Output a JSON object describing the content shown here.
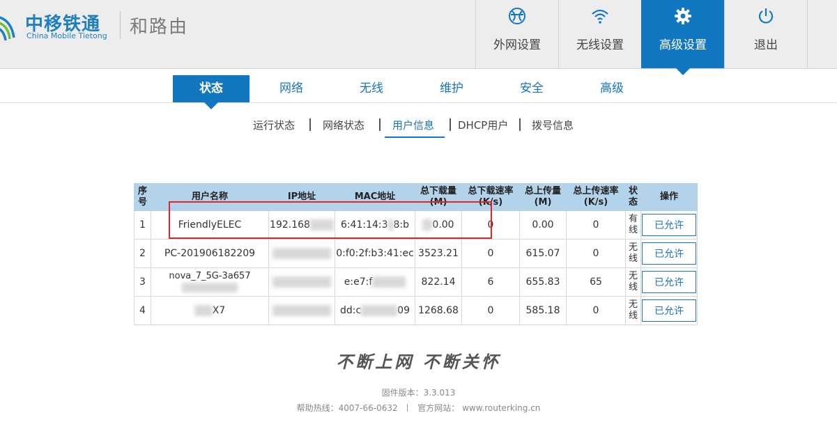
{
  "brand": {
    "name_cn": "中移铁通",
    "name_en": "China Mobile Tietong",
    "product": "和路由",
    "color": "#1d7fc4"
  },
  "top_nav": [
    {
      "label": "外网设置",
      "icon": "globe-icon"
    },
    {
      "label": "无线设置",
      "icon": "wifi-icon"
    },
    {
      "label": "高级设置",
      "icon": "gear-icon",
      "active": true
    },
    {
      "label": "退出",
      "icon": "power-icon"
    }
  ],
  "sub_tabs": [
    {
      "label": "状态",
      "active": true
    },
    {
      "label": "网络"
    },
    {
      "label": "无线"
    },
    {
      "label": "维护"
    },
    {
      "label": "安全"
    },
    {
      "label": "高级"
    }
  ],
  "third_nav": [
    {
      "label": "运行状态"
    },
    {
      "label": "网络状态"
    },
    {
      "label": "用户信息",
      "active": true
    },
    {
      "label": "DHCP用户"
    },
    {
      "label": "拨号信息"
    }
  ],
  "table": {
    "headers": [
      "序号",
      "用户名称",
      "IP地址",
      "MAC地址",
      "总下载量(M)",
      "总下载速率(K/s)",
      "总上传量(M)",
      "总上传速率(K/s)",
      "状态",
      "操作"
    ],
    "rows": [
      {
        "index": "1",
        "name": "FriendlyELEC",
        "ip": "192.168",
        "mac_a": "6:41:14:3",
        "mac_b": "8:b",
        "dl_total": "0.00",
        "dl_rate": "0",
        "ul_total": "0.00",
        "ul_rate": "0",
        "status": "有线",
        "action": "已允许"
      },
      {
        "index": "2",
        "name": "PC-201906182209",
        "ip": "",
        "mac_a": "0:f0:2f:b3:41:ec",
        "mac_b": "",
        "dl_total": "3523.21",
        "dl_rate": "0",
        "ul_total": "615.07",
        "ul_rate": "0",
        "status": "无线",
        "action": "已允许"
      },
      {
        "index": "3",
        "name": "nova_7_5G-3a657",
        "ip": "",
        "mac_a": "e:e7:f",
        "mac_b": "",
        "dl_total": "822.14",
        "dl_rate": "6",
        "ul_total": "655.83",
        "ul_rate": "65",
        "status": "无线",
        "action": "已允许"
      },
      {
        "index": "4",
        "name": "X7",
        "ip": "",
        "mac_a": "dd:c",
        "mac_b": "09",
        "dl_total": "1268.68",
        "dl_rate": "0",
        "ul_total": "585.18",
        "ul_rate": "0",
        "status": "无线",
        "action": "已允许"
      }
    ]
  },
  "footer": {
    "slogan": "不断上网  不断关怀",
    "firmware": "固件版本：3.3.013",
    "hotline": "帮助热线：4007-66-0632",
    "website": "官方网站：  www.routerking.cn"
  }
}
